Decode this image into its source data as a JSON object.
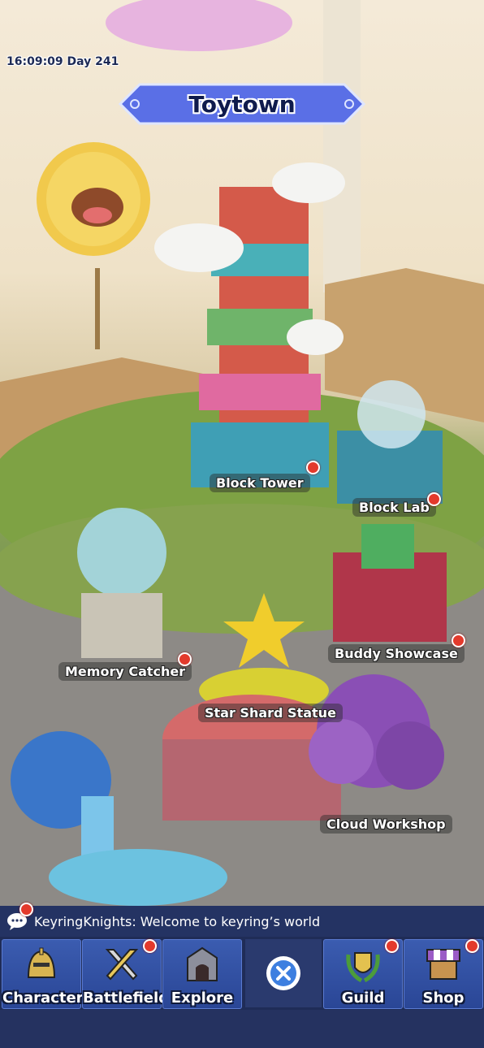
{
  "header": {
    "clock": "16:09:09 Day 241",
    "town_name": "Toytown"
  },
  "locations": [
    {
      "key": "block_tower",
      "label": "Block Tower",
      "has_alert": true
    },
    {
      "key": "block_lab",
      "label": "Block Lab",
      "has_alert": true
    },
    {
      "key": "buddy_showcase",
      "label": "Buddy Showcase",
      "has_alert": true
    },
    {
      "key": "memory_catcher",
      "label": "Memory Catcher",
      "has_alert": true
    },
    {
      "key": "star_shard_statue",
      "label": "Star Shard Statue",
      "has_alert": false
    },
    {
      "key": "cloud_workshop",
      "label": "Cloud Workshop",
      "has_alert": false
    }
  ],
  "chat": {
    "message": "KeyringKnights: Welcome to keyring’s world",
    "has_alert": true
  },
  "nav": [
    {
      "label": "Character",
      "icon": "knight-helmet-icon",
      "has_alert": false
    },
    {
      "label": "Battlefield",
      "icon": "crossed-swords-icon",
      "has_alert": true
    },
    {
      "label": "Explore",
      "icon": "gate-icon",
      "has_alert": false
    },
    {
      "label": "",
      "icon": "close-icon",
      "has_alert": false
    },
    {
      "label": "Guild",
      "icon": "laurel-shield-icon",
      "has_alert": true
    },
    {
      "label": "Shop",
      "icon": "market-stall-icon",
      "has_alert": true
    }
  ],
  "colors": {
    "alert": "#e33a2c",
    "banner": "#5b6de8",
    "nav_button": "#3b5cb0"
  }
}
